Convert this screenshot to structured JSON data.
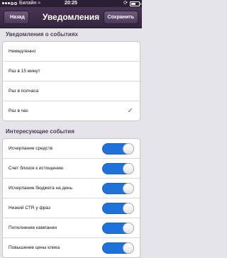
{
  "statusbar": {
    "carrier": "Билайн",
    "time": "20:25",
    "battery_level": 0.6
  },
  "navbar": {
    "title": "Уведомления",
    "back_label": "Назад",
    "save_label": "Сохранить"
  },
  "section_frequency": {
    "header": "Уведомления о событиях",
    "options": [
      {
        "label": "Немедленно",
        "selected": false
      },
      {
        "label": "Раз в 15 минут",
        "selected": false
      },
      {
        "label": "Раз в полчаса",
        "selected": false
      },
      {
        "label": "Раз в час",
        "selected": true
      }
    ],
    "check_glyph": "✓"
  },
  "section_events": {
    "header": "Интересующие события",
    "items": [
      {
        "label": "Исчерпание средств",
        "enabled": true
      },
      {
        "label": "Счет близок к истощению",
        "enabled": true
      },
      {
        "label": "Исчерпание бюджета на день",
        "enabled": true
      },
      {
        "label": "Низкий CTR у фраз",
        "enabled": true
      },
      {
        "label": "Пополнение кампании",
        "enabled": true
      },
      {
        "label": "Повышение цены клика",
        "enabled": true
      }
    ]
  },
  "colors": {
    "accent": "#1f72d9",
    "nav": "#3d2b48",
    "check": "#2f6fd6"
  }
}
